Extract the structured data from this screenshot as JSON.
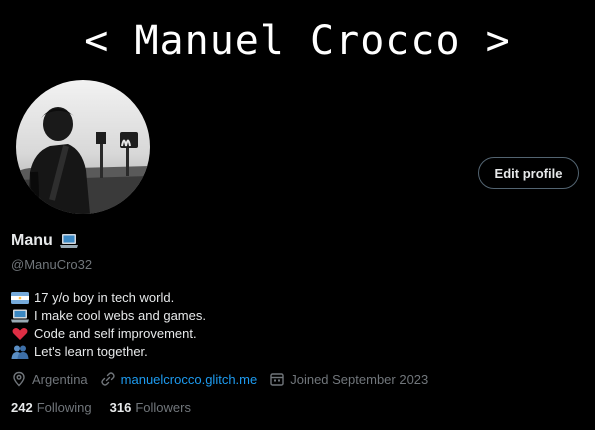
{
  "banner": {
    "text": "< Manuel Crocco >"
  },
  "profile": {
    "edit_label": "Edit profile",
    "display_name": "Manu",
    "handle": "@ManuCro32",
    "bio_lines": [
      {
        "icon": "argentina-flag-icon",
        "text": "17 y/o boy in tech world."
      },
      {
        "icon": "laptop-icon",
        "text": "I make cool webs and games."
      },
      {
        "icon": "heart-icon",
        "text": "Code and self improvement."
      },
      {
        "icon": "people-hugging-icon",
        "text": "Let's learn together."
      }
    ],
    "location": "Argentina",
    "website": "manuelcrocco.glitch.me",
    "joined": "Joined September 2023",
    "following_count": "242",
    "following_label": "Following",
    "followers_count": "316",
    "followers_label": "Followers"
  },
  "colors": {
    "background": "#000000",
    "text_primary": "#e7e9ea",
    "text_secondary": "#71767b",
    "link": "#1d9bf0",
    "heart": "#e0245e"
  }
}
